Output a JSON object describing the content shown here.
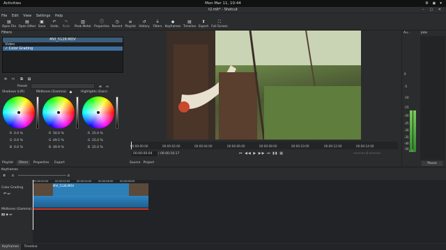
{
  "topbar": {
    "activities": "Activities",
    "clock": "Mon Mar 11, 10:44",
    "tray": "⚙ ◉ ▾"
  },
  "window": {
    "title": "t2.mlt* - Shotcut",
    "controls": "– ▢ ✕"
  },
  "menu": [
    "File",
    "Edit",
    "View",
    "Settings",
    "Help"
  ],
  "toolbar": [
    {
      "label": "Open File",
      "icon": "▤"
    },
    {
      "label": "Open Other",
      "icon": "▤"
    },
    {
      "label": "Save",
      "icon": "▣"
    },
    {
      "label": "Undo",
      "icon": "↶"
    },
    {
      "label": "Redo",
      "icon": "↷"
    },
    {
      "label": "Peak Meter",
      "icon": "▥"
    },
    {
      "label": "Properties",
      "icon": "ⓘ"
    },
    {
      "label": "Recent",
      "icon": "◷"
    },
    {
      "label": "Playlist",
      "icon": "≡"
    },
    {
      "label": "History",
      "icon": "↺"
    },
    {
      "label": "Filters",
      "icon": "⏚"
    },
    {
      "label": "Keyframes",
      "icon": "◆"
    },
    {
      "label": "Timeline",
      "icon": "▤"
    },
    {
      "label": "Export",
      "icon": "⬆"
    },
    {
      "label": "Full Screen",
      "icon": "⛶"
    }
  ],
  "filters": {
    "title": "Filters",
    "clip_name": "MVI_5128.MOV",
    "group": "Video",
    "selected": "✓ Color Grading",
    "preset_label": "Preset",
    "wheels": [
      {
        "label": "Shadows (Lift)",
        "values": [
          {
            "c": "R",
            "v": "0.0 %"
          },
          {
            "c": "G",
            "v": "0.0 %"
          },
          {
            "c": "B",
            "v": "0.0 %"
          }
        ]
      },
      {
        "label": "Midtones (Gamma)",
        "values": [
          {
            "c": "R",
            "v": "50.0 %"
          },
          {
            "c": "G",
            "v": "49.5 %"
          },
          {
            "c": "B",
            "v": "49.9 %"
          }
        ]
      },
      {
        "label": "Highlights (Gain)",
        "values": [
          {
            "c": "R",
            "v": "25.0 %"
          },
          {
            "c": "G",
            "v": "25.0 %"
          },
          {
            "c": "B",
            "v": "25.0 %"
          }
        ]
      }
    ]
  },
  "left_tabs": [
    "Playlist",
    "Filters",
    "Properties",
    "Export"
  ],
  "viewer": {
    "ruler": [
      "00:00:00:00",
      "00:00:02:00",
      "00:00:04:00",
      "00:00:06:00",
      "00:00:08:00",
      "00:00:10:00",
      "00:00:12:00",
      "00:00:14:00"
    ],
    "timecode": "00:00:00:04",
    "duration": "/ 00:00:16:17",
    "transport": "⏮ ◀◀ ▶ ▶▶ ⏭ ▮▮ ▦",
    "timecode_right": "--:--:--:-- / --:--:--:--",
    "tabs": [
      "Source",
      "Project"
    ]
  },
  "audio": {
    "title": "Au...",
    "labels": [
      "0",
      "-5",
      "-10",
      "-15",
      "-20",
      "-25",
      "-30",
      "-35",
      "-40",
      "-50"
    ],
    "lr": "L R"
  },
  "jobs": {
    "title": "Jobs",
    "pause": "Pause"
  },
  "timeline": {
    "title": "Keyframes",
    "clip_label": "MVI_5128.MOV",
    "tracks": [
      "Color Grading",
      "Midtones (Gamma)"
    ],
    "ticks": [
      "00:00:00:00",
      "00:00:02:00",
      "00:00:04:00",
      "00:00:06:00",
      "00:00:08:00",
      "00:00:10:00",
      "00:00:12:00",
      "00:00:14:00"
    ]
  },
  "bottom_tabs": [
    "Keyframes",
    "Timeline"
  ]
}
